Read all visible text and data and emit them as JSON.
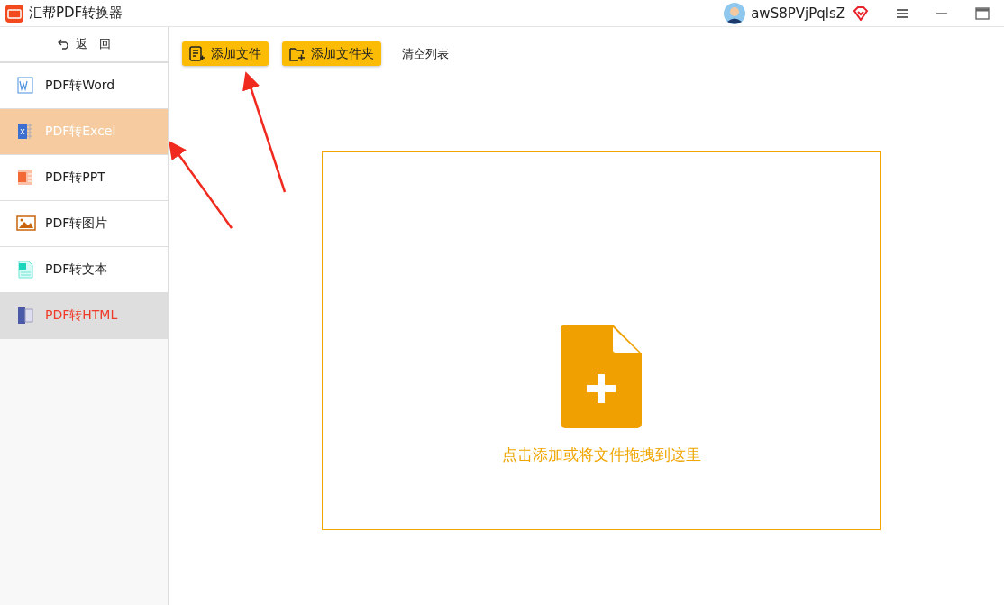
{
  "window": {
    "title": "汇帮PDF转换器",
    "username": "awS8PVjPqlsZ"
  },
  "sidebar": {
    "back": "返　回",
    "items": [
      {
        "kind": "word",
        "label": "PDF转Word",
        "selected": false,
        "hovered": false
      },
      {
        "kind": "excel",
        "label": "PDF转Excel",
        "selected": true,
        "hovered": false
      },
      {
        "kind": "ppt",
        "label": "PDF转PPT",
        "selected": false,
        "hovered": false
      },
      {
        "kind": "image",
        "label": "PDF转图片",
        "selected": false,
        "hovered": false
      },
      {
        "kind": "text",
        "label": "PDF转文本",
        "selected": false,
        "hovered": false
      },
      {
        "kind": "html",
        "label": "PDF转HTML",
        "selected": false,
        "hovered": true
      }
    ]
  },
  "toolbar": {
    "buttons": [
      {
        "kind": "file",
        "label": "添加文件"
      },
      {
        "kind": "folder",
        "label": "添加文件夹"
      }
    ],
    "clear": "清空列表"
  },
  "dropzone": {
    "hint": "点击添加或将文件拖拽到这里"
  }
}
